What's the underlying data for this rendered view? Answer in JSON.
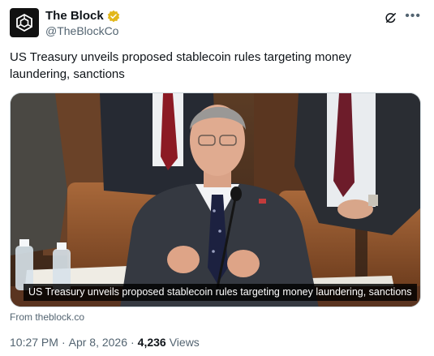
{
  "author": {
    "name": "The Block",
    "handle": "@TheBlockCo",
    "verified_color": "#e2b719"
  },
  "tweet": {
    "text": "US Treasury unveils proposed stablecoin rules targeting money laundering, sanctions"
  },
  "card": {
    "caption": "US Treasury unveils proposed stablecoin rules targeting money laundering, sanctions",
    "source": "From theblock.co"
  },
  "meta": {
    "time": "10:27 PM",
    "separator": "·",
    "date": "Apr 8, 2026",
    "views_count": "4,236",
    "views_label": "Views"
  },
  "icons": {
    "avatar": "the-block-logo-icon",
    "verified": "verified-badge-icon",
    "grok": "grok-icon",
    "more": "more-icon"
  },
  "colors": {
    "text": "#0f1419",
    "secondary": "#536471",
    "border": "#cfd9de"
  }
}
